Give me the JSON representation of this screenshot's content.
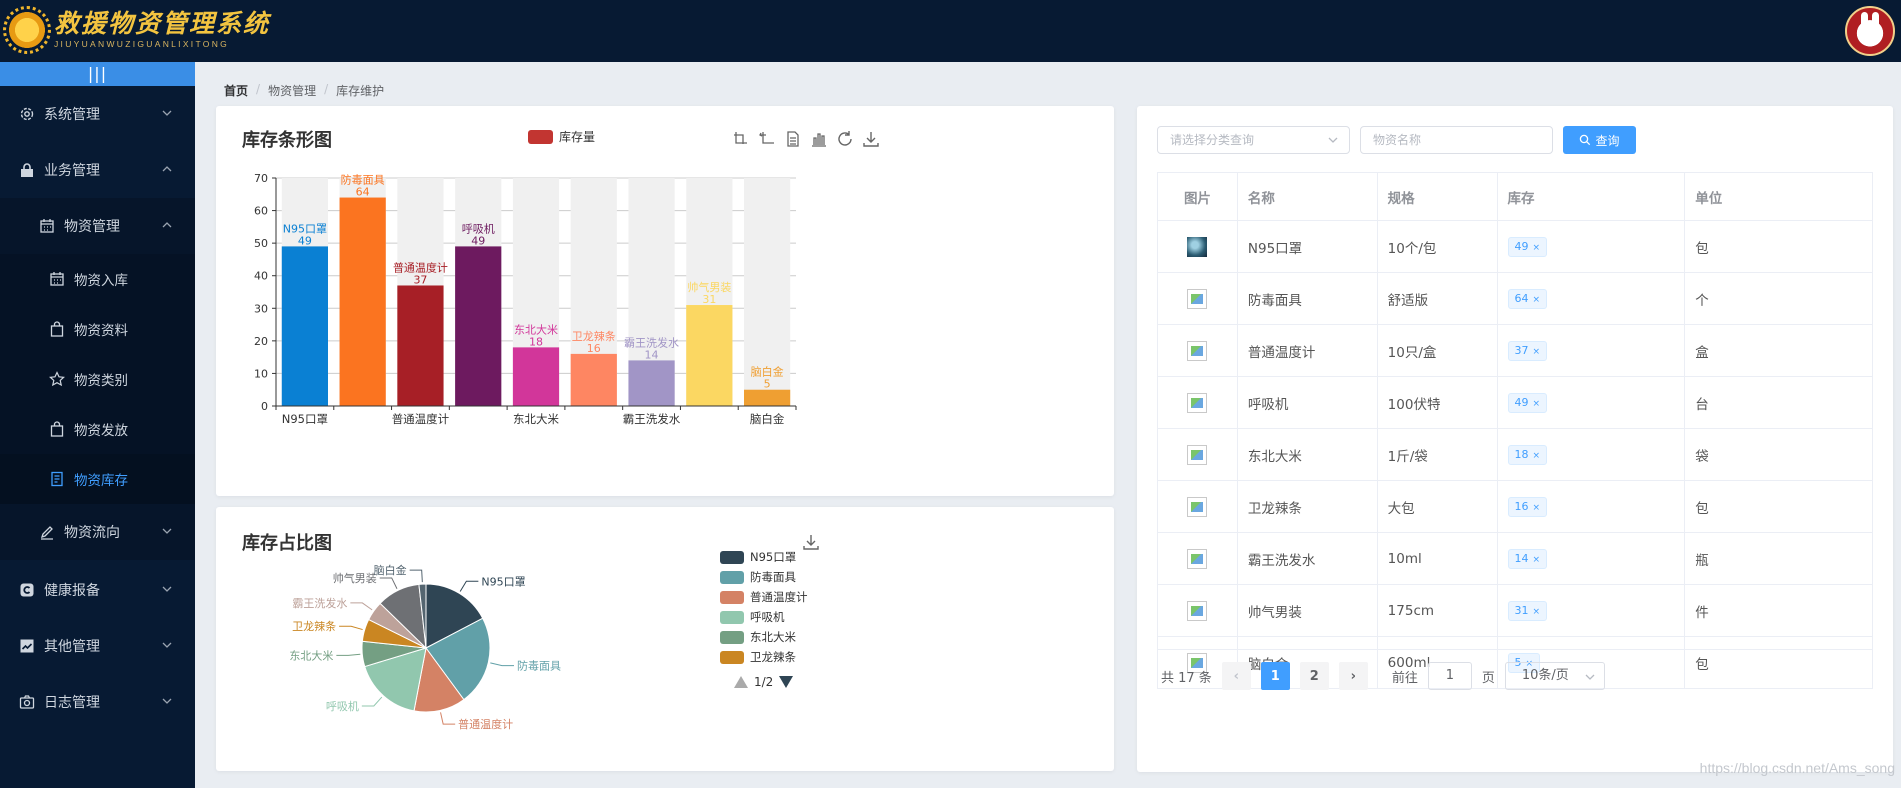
{
  "header": {
    "app_title": "救援物资管理系统",
    "app_subtitle": "JIUYUANWUZIGUANLIXITONG"
  },
  "sidebar": {
    "collapse_label": "|||",
    "items": [
      {
        "label": "系统管理",
        "icon": "gear-icon"
      },
      {
        "label": "业务管理",
        "icon": "lock-icon"
      },
      {
        "label": "物资管理",
        "icon": "calendar-icon"
      },
      {
        "label": "物资入库",
        "icon": "calendar-icon"
      },
      {
        "label": "物资资料",
        "icon": "bag-icon"
      },
      {
        "label": "物资类别",
        "icon": "star-icon"
      },
      {
        "label": "物资发放",
        "icon": "bag-icon"
      },
      {
        "label": "物资库存",
        "icon": "document-icon"
      },
      {
        "label": "物资流向",
        "icon": "pen-icon"
      },
      {
        "label": "健康报备",
        "icon": "cc-icon"
      },
      {
        "label": "其他管理",
        "icon": "chart-icon"
      },
      {
        "label": "日志管理",
        "icon": "camera-icon"
      }
    ]
  },
  "breadcrumb": {
    "home": "首页",
    "level1": "物资管理",
    "level2": "库存维护"
  },
  "bar_panel": {
    "title": "库存条形图",
    "legend_label": "库存量",
    "legend_color": "#c23531"
  },
  "pie_panel": {
    "title": "库存占比图",
    "page_indicator": "1/2"
  },
  "chart_data": [
    {
      "type": "bar",
      "title": "库存条形图",
      "categories": [
        "N95口罩",
        "防毒面具",
        "普通温度计",
        "呼吸机",
        "东北大米",
        "卫龙辣条",
        "霸王洗发水",
        "帅气男装",
        "脑白金"
      ],
      "x_tick_labels": [
        "N95口罩",
        "普通温度计",
        "东北大米",
        "霸王洗发水",
        "脑白金"
      ],
      "series": [
        {
          "name": "库存量",
          "values": [
            49,
            64,
            37,
            49,
            18,
            16,
            14,
            31,
            5
          ]
        }
      ],
      "colors": [
        "#0a80d3",
        "#fb7420",
        "#a71f26",
        "#6d1a5f",
        "#d2369a",
        "#fe8662",
        "#a195c6",
        "#fbd762",
        "#ef9f32"
      ],
      "ylim": [
        0,
        70
      ],
      "yticks": [
        0,
        10,
        20,
        30,
        40,
        50,
        60,
        70
      ],
      "grid": true
    },
    {
      "type": "pie",
      "title": "库存占比图",
      "categories": [
        "N95口罩",
        "防毒面具",
        "普通温度计",
        "呼吸机",
        "东北大米",
        "卫龙辣条",
        "霸王洗发水",
        "帅气男装",
        "脑白金"
      ],
      "values": [
        49,
        64,
        37,
        49,
        18,
        16,
        14,
        31,
        5
      ],
      "colors": [
        "#2f4554",
        "#61a0a8",
        "#d48265",
        "#91c7ae",
        "#749f83",
        "#ca8622",
        "#bda29a",
        "#6e7074",
        "#546570"
      ],
      "legend_visible": [
        "N95口罩",
        "防毒面具",
        "普通温度计",
        "呼吸机",
        "东北大米",
        "卫龙辣条",
        "霸王洗发水"
      ],
      "legend_position": "right"
    }
  ],
  "search": {
    "category_placeholder": "请选择分类查询",
    "name_placeholder": "物资名称",
    "button_label": "查询"
  },
  "table": {
    "headers": [
      "图片",
      "名称",
      "规格",
      "库存",
      "单位"
    ],
    "rows": [
      {
        "name": "N95口罩",
        "spec": "10个/包",
        "stock": "49",
        "unit": "包",
        "image": "photo"
      },
      {
        "name": "防毒面具",
        "spec": "舒适版",
        "stock": "64",
        "unit": "个",
        "image": "broken"
      },
      {
        "name": "普通温度计",
        "spec": "10只/盒",
        "stock": "37",
        "unit": "盒",
        "image": "broken"
      },
      {
        "name": "呼吸机",
        "spec": "100伏特",
        "stock": "49",
        "unit": "台",
        "image": "broken"
      },
      {
        "name": "东北大米",
        "spec": "1斤/袋",
        "stock": "18",
        "unit": "袋",
        "image": "broken"
      },
      {
        "name": "卫龙辣条",
        "spec": "大包",
        "stock": "16",
        "unit": "包",
        "image": "broken"
      },
      {
        "name": "霸王洗发水",
        "spec": "10ml",
        "stock": "14",
        "unit": "瓶",
        "image": "broken"
      },
      {
        "name": "帅气男装",
        "spec": "175cm",
        "stock": "31",
        "unit": "件",
        "image": "broken"
      },
      {
        "name": "脑白金",
        "spec": "600ml",
        "stock": "5",
        "unit": "包",
        "image": "broken"
      }
    ]
  },
  "pagination": {
    "total_text": "共 17 条",
    "pages": [
      "1",
      "2"
    ],
    "current": "1",
    "goto_label": "前往",
    "goto_value": "1",
    "page_unit": "页",
    "page_size": "10条/页"
  },
  "watermark": "https://blog.csdn.net/Ams_song"
}
